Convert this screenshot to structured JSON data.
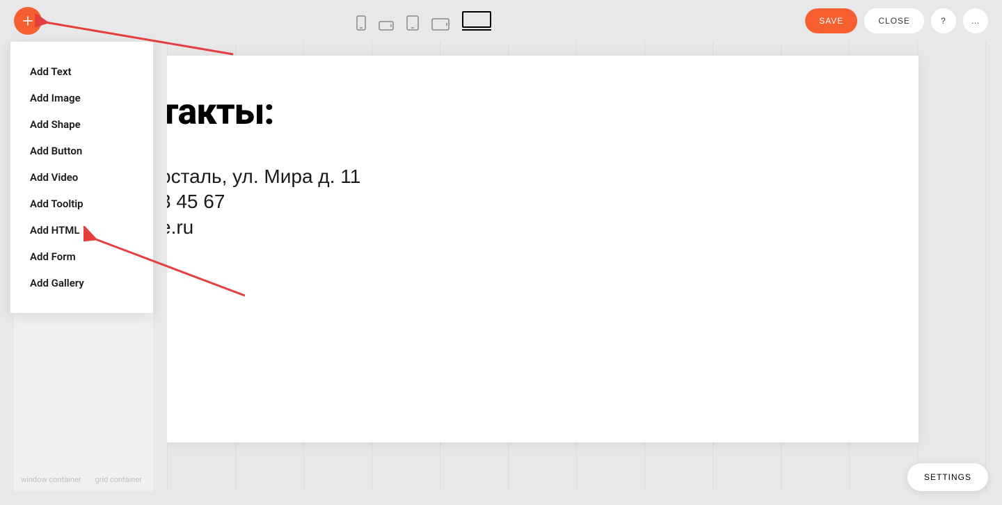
{
  "toolbar": {
    "save": "SAVE",
    "close": "CLOSE",
    "help": "?",
    "more": "…"
  },
  "add_menu": {
    "items": [
      "Add Text",
      "Add Image",
      "Add Shape",
      "Add Button",
      "Add Video",
      "Add Tooltip",
      "Add HTML",
      "Add Form",
      "Add Gallery"
    ]
  },
  "canvas": {
    "heading": "такты:",
    "line1": "осталь, ул. Мира д. 11",
    "line2": "3 45 67",
    "line3": "e.ru"
  },
  "sidebar": {
    "label1": "window container",
    "label2": "grid container"
  },
  "settings": "SETTINGS"
}
